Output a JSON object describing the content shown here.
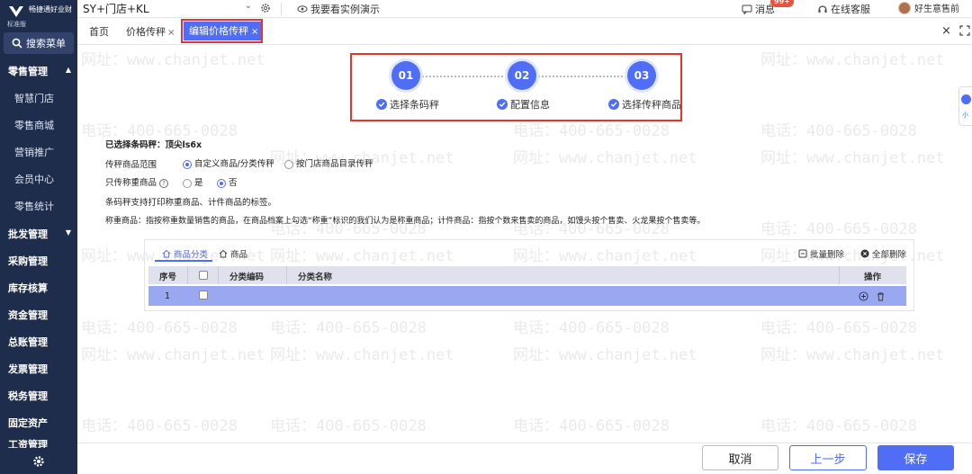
{
  "brand": {
    "name": "畅捷通好业财",
    "edition": "标准版"
  },
  "sidebar": {
    "search_label": "搜索菜单",
    "groups": [
      {
        "label": "零售管理",
        "expanded": true,
        "items": [
          "智慧门店",
          "零售商城",
          "营销推广",
          "会员中心",
          "零售统计"
        ]
      },
      {
        "label": "批发管理"
      },
      {
        "label": "采购管理"
      },
      {
        "label": "库存核算"
      },
      {
        "label": "资金管理"
      },
      {
        "label": "总账管理"
      },
      {
        "label": "发票管理"
      },
      {
        "label": "税务管理"
      },
      {
        "label": "固定资产"
      },
      {
        "label": "工资管理"
      }
    ]
  },
  "topbar": {
    "store": "SY+门店+KL",
    "demo": "我要看实例演示",
    "messages": "消息",
    "message_badge": "99+",
    "service": "在线客服",
    "user": "好生意售前"
  },
  "tabs": [
    {
      "label": "首页"
    },
    {
      "label": "价格传秤",
      "close": "×"
    },
    {
      "label": "编辑价格传秤",
      "close": "×",
      "active": true
    }
  ],
  "steps": [
    {
      "num": "01",
      "label": "选择条码秤"
    },
    {
      "num": "02",
      "label": "配置信息"
    },
    {
      "num": "03",
      "label": "选择传秤商品"
    }
  ],
  "form": {
    "selected_scale_label": "已选择条码秤：",
    "selected_scale_value": "顶尖ls6x",
    "range_label": "传秤商品范围",
    "range_options": [
      "自定义商品/分类传秤",
      "按门店商品目录传秤"
    ],
    "range_selected": 0,
    "weigh_only_label": "只传称重商品",
    "weigh_options": [
      "是",
      "否"
    ],
    "weigh_selected": 1,
    "note1": "条码秤支持打印称重商品、计件商品的标签。",
    "note2": "称重商品：指按称重数量销售的商品，在商品档案上勾选“称重”标识的我们认为是称重商品；计件商品：指按个数来售卖的商品，如馒头按个售卖、火龙果按个售卖等。"
  },
  "panel": {
    "tabs": [
      "商品分类",
      "商品"
    ],
    "active_tab": 0,
    "batch_delete": "批量删除",
    "delete_all": "全部删除",
    "columns": [
      "序号",
      "分类编码",
      "分类名称",
      "操作"
    ],
    "rows": [
      {
        "index": "1",
        "code": "",
        "name": ""
      }
    ]
  },
  "footer": {
    "cancel": "取消",
    "prev": "上一步",
    "save": "保存"
  },
  "watermark": {
    "phone": "电话：400-665-0028",
    "site": "网址：www.chanjet.net"
  },
  "float_label": "小"
}
